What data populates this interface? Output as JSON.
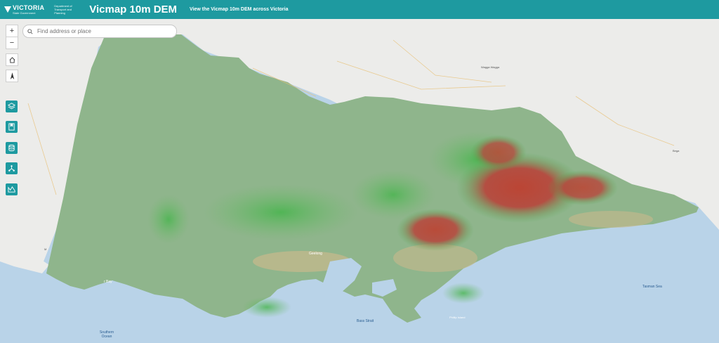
{
  "header": {
    "logo_text": "VICTORIA",
    "logo_sub": "State Government",
    "department": "Department of Transport and Planning",
    "title": "Vicmap 10m DEM",
    "subtitle": "View the Vicmap 10m DEM across Victoria"
  },
  "search": {
    "placeholder": "Find address or place"
  },
  "controls": {
    "zoom_in": "+",
    "zoom_out": "−"
  },
  "tools": [
    "layers-icon",
    "bookmark-icon",
    "basemap-icon",
    "share-icon",
    "elevation-profile-icon"
  ],
  "map_labels": {
    "geelong": "Geelong",
    "melbourne": "Melbourne",
    "wagga": "Wagga Wagga",
    "bega": "Bega",
    "portland_bay": "r Bay",
    "bass_strait": "Bass Strait",
    "tasman_sea": "Tasman Sea",
    "southern_ocean": "Southern Ocean",
    "phillip_island": "Phillip Island",
    "m": "M"
  }
}
